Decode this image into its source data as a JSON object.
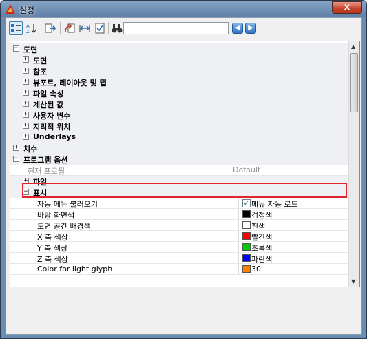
{
  "window": {
    "title": "설정",
    "close_label": "x"
  },
  "toolbar": {
    "search_value": "",
    "nav_back": "◀",
    "nav_forward": "▶"
  },
  "tree": {
    "drawing": {
      "label": "도면",
      "children": [
        "도면",
        "참조",
        "뷰포트, 레이아웃 및 탭",
        "파일 속성",
        "계산된 값",
        "사용자 변수",
        "지리적 위치",
        "Underlays"
      ]
    },
    "dimensions": {
      "label": "치수"
    },
    "program_options": {
      "label": "프로그램 옵션",
      "current_profile": {
        "name": "현재 프로필",
        "value": "Default"
      },
      "file": {
        "label": "파일"
      },
      "display": {
        "label": "표시",
        "props": [
          {
            "name": "자동 메뉴 불러오기",
            "value": "메뉴 자동 로드",
            "kind": "checkbox",
            "checked": true
          },
          {
            "name": "바탕 화면색",
            "value": "검정색",
            "kind": "color",
            "color": "#000000"
          },
          {
            "name": "도면 공간 배경색",
            "value": "흰색",
            "kind": "color",
            "color": "#ffffff"
          },
          {
            "name": "X 축 색상",
            "value": "빨간색",
            "kind": "color",
            "color": "#ff0000"
          },
          {
            "name": "Y 축 색상",
            "value": "초록색",
            "kind": "color",
            "color": "#00cc00"
          },
          {
            "name": "Z 축 색상",
            "value": "파란색",
            "kind": "color",
            "color": "#0000ff"
          },
          {
            "name": "Color for light glyph",
            "value": "30",
            "kind": "color",
            "color": "#ff8000"
          }
        ]
      }
    }
  },
  "colors": {
    "highlight_border": "#e0242b",
    "category_bg": "#eef0f4"
  }
}
